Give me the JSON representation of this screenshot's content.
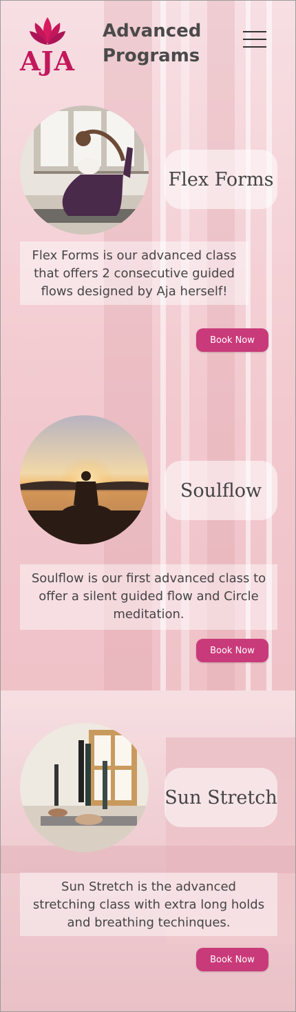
{
  "brand": {
    "logo_text": "AJA",
    "logo_icon": "lotus-icon"
  },
  "header": {
    "title_line1": "Advanced",
    "title_line2": "Programs",
    "menu_icon": "hamburger-menu-icon"
  },
  "colors": {
    "accent": "#c93a7a",
    "brand": "#c2185b",
    "text": "#444444"
  },
  "programs": [
    {
      "name": "Flex Forms",
      "description": "Flex Forms is our advanced class that offers 2 consecutive guided flows designed by Aja herself!",
      "button_label": "Book Now"
    },
    {
      "name": "Soulflow",
      "description": "Soulflow is our first advanced class to offer a silent guided flow and Circle meditation.",
      "button_label": "Book Now"
    },
    {
      "name": "Sun Stretch",
      "description": "Sun Stretch is the advanced stretching class with extra long holds and breathing techinques.",
      "button_label": "Book Now"
    }
  ]
}
